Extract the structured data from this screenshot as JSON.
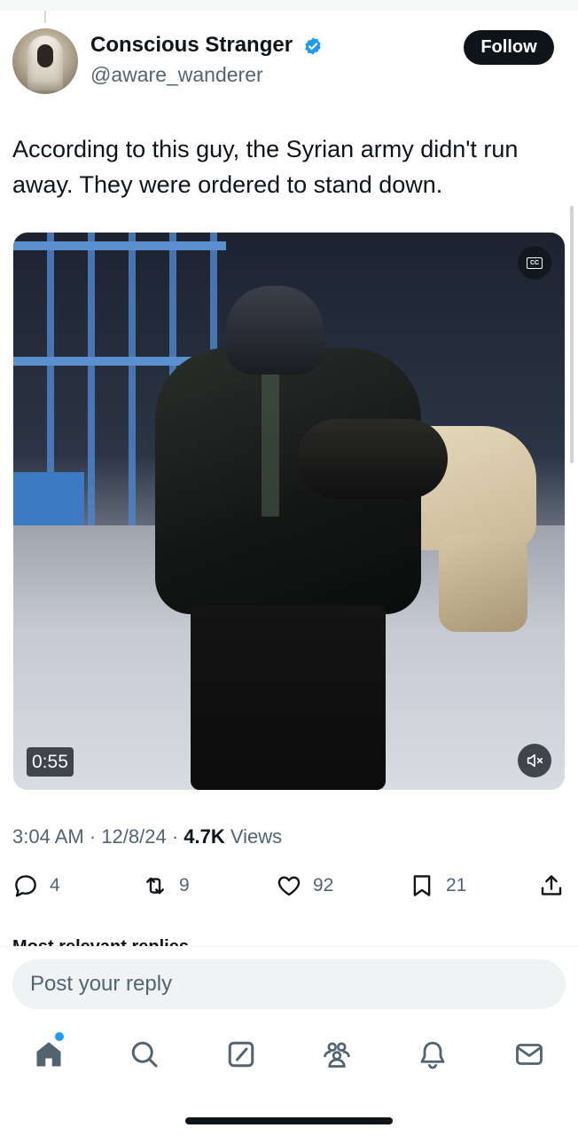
{
  "tweet": {
    "author_name": "Conscious Stranger",
    "author_handle": "@aware_wanderer",
    "follow_label": "Follow",
    "text": "According to this guy, the Syrian army didn't run away. They were ordered to stand down.",
    "time": "3:04 AM",
    "date": "12/8/24",
    "separator": "·",
    "views_count": "4.7K",
    "views_label": "Views"
  },
  "media": {
    "duration": "0:55",
    "cc_label": "CC"
  },
  "actions": {
    "replies": "4",
    "reposts": "9",
    "likes": "92",
    "bookmarks": "21"
  },
  "replies": {
    "sort_label": "Most relevant replies",
    "reply_placeholder": "Post your reply"
  },
  "colors": {
    "accent": "#1d9bf0",
    "text": "#0f1419",
    "secondary": "#536471"
  },
  "icons": [
    "verified-badge-icon",
    "cc-icon",
    "mute-icon",
    "reply-icon",
    "repost-icon",
    "like-icon",
    "bookmark-icon",
    "share-icon",
    "home-icon",
    "search-icon",
    "compose-icon",
    "communities-icon",
    "notifications-icon",
    "messages-icon"
  ]
}
